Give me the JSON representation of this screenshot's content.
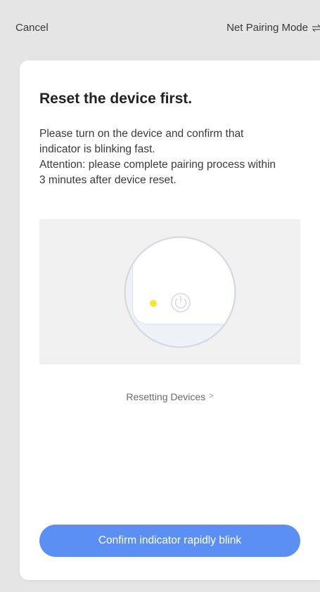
{
  "header": {
    "cancel_label": "Cancel",
    "mode_label": "Net Pairing Mode",
    "mode_icon": "swap-arrows-icon"
  },
  "card": {
    "title": "Reset the device first.",
    "description_line1": "Please turn on the device and confirm that indicator is blinking fast.",
    "description_line2": "Attention: please complete pairing process within 3 minutes after device reset.",
    "illustration_icons": [
      "indicator-light-icon",
      "power-icon"
    ],
    "indicator_color": "#f5e630",
    "reset_link_label": "Resetting Devices",
    "reset_link_icon": "chevron-right-icon",
    "confirm_button_label": "Confirm indicator rapidly blink"
  },
  "colors": {
    "background": "#e5e5e5",
    "card": "#ffffff",
    "accent": "#5b8ff3",
    "illustration_bg": "#f0f0f0"
  }
}
